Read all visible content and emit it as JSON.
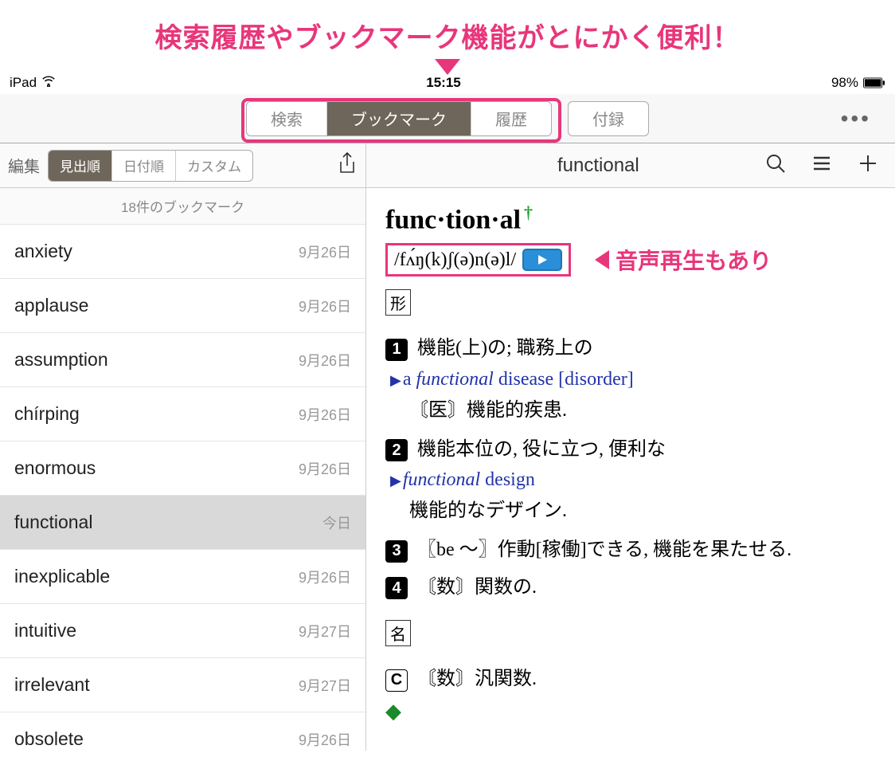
{
  "annotation": {
    "top": "検索履歴やブックマーク機能がとにかく便利！",
    "audio": "音声再生もあり"
  },
  "statusBar": {
    "device": "iPad",
    "time": "15:15",
    "battery": "98%"
  },
  "navTabs": {
    "search": "検索",
    "bookmark": "ブックマーク",
    "history": "履歴",
    "appendix": "付録"
  },
  "leftPanel": {
    "edit": "編集",
    "sort": {
      "headword": "見出順",
      "date": "日付順",
      "custom": "カスタム"
    },
    "countText": "18件のブックマーク",
    "items": [
      {
        "word": "anxiety",
        "date": "9月26日",
        "selected": false
      },
      {
        "word": "applause",
        "date": "9月26日",
        "selected": false
      },
      {
        "word": "assumption",
        "date": "9月26日",
        "selected": false
      },
      {
        "word": "chírping",
        "date": "9月26日",
        "selected": false
      },
      {
        "word": "enormous",
        "date": "9月26日",
        "selected": false
      },
      {
        "word": "functional",
        "date": "今日",
        "selected": true
      },
      {
        "word": "inexplicable",
        "date": "9月26日",
        "selected": false
      },
      {
        "word": "intuitive",
        "date": "9月27日",
        "selected": false
      },
      {
        "word": "irrelevant",
        "date": "9月27日",
        "selected": false
      },
      {
        "word": "obsolete",
        "date": "9月26日",
        "selected": false
      }
    ]
  },
  "rightPanel": {
    "title": "functional",
    "headword": "func·tion·al",
    "phonetic": "/fʌ́ŋ(k)ʃ(ə)n(ə)l/",
    "posAdj": "形",
    "posNoun": "名",
    "defs": {
      "d1": "機能(上)の; 職務上の",
      "ex1a": "a ",
      "ex1b": "functional",
      "ex1c": " disease [disorder]",
      "ex1trans": "〘医〙機能的疾患.",
      "d2": "機能本位の, 役に立つ, 便利な",
      "ex2a": "functional",
      "ex2b": " design",
      "ex2trans": "機能的なデザイン.",
      "d3": "〖be ～〗作動[稼働]できる, 機能を果たせる.",
      "d4": "〘数〙関数の.",
      "nC": "〘数〙汎関数."
    }
  }
}
